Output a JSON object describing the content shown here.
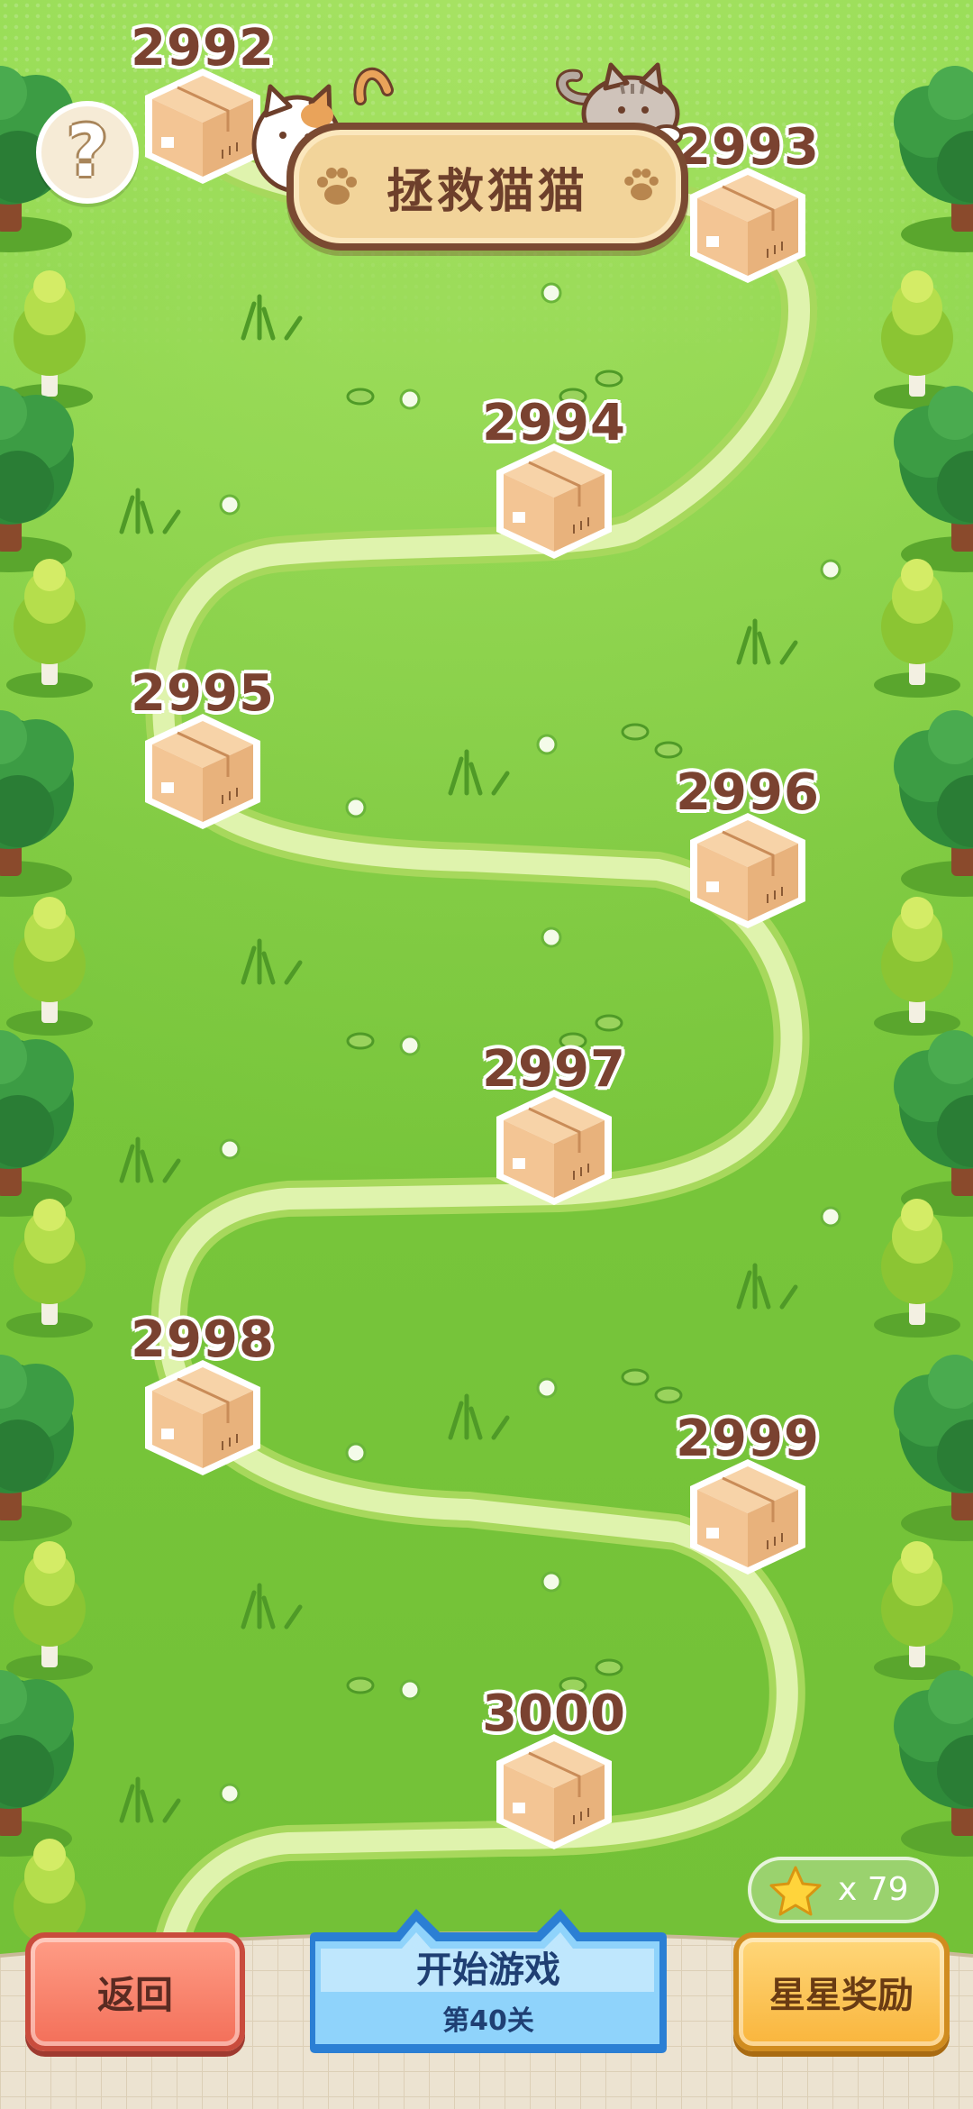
{
  "header": {
    "help_label": "?",
    "title": "拯救猫猫"
  },
  "levels": [
    {
      "number": "2992",
      "locked": true
    },
    {
      "number": "2993",
      "locked": true
    },
    {
      "number": "2994",
      "locked": true
    },
    {
      "number": "2995",
      "locked": true
    },
    {
      "number": "2996",
      "locked": true
    },
    {
      "number": "2997",
      "locked": true
    },
    {
      "number": "2998",
      "locked": true
    },
    {
      "number": "2999",
      "locked": true
    },
    {
      "number": "3000",
      "locked": true
    }
  ],
  "stars": {
    "icon": "star-icon",
    "count_text": "x 79"
  },
  "footer": {
    "back_label": "返回",
    "start_label": "开始游戏",
    "start_sublabel": "第40关",
    "star_reward_label": "星星奖励"
  },
  "colors": {
    "grass": "#7cc93f",
    "path": "#d8f2a6",
    "box": "#f0c89b",
    "level_number": "#7a4230",
    "back_button": "#f36f59",
    "start_button": "#6dbef4",
    "reward_button": "#f9b53c"
  }
}
